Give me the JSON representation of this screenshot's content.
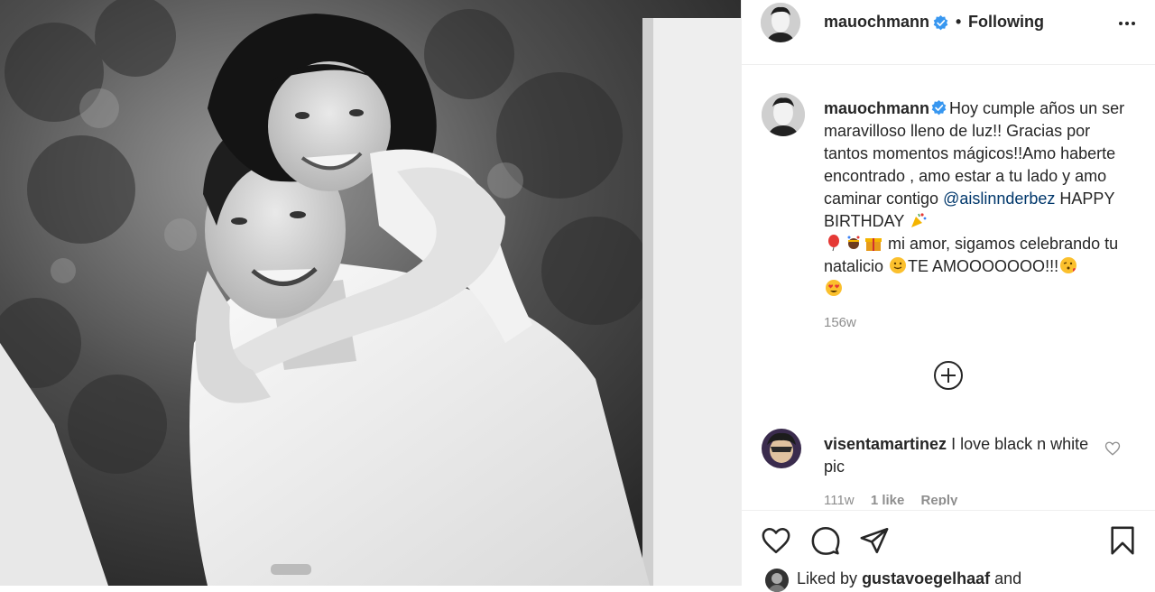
{
  "post": {
    "author": "mauochmann",
    "follow_status": "Following",
    "separator": "•"
  },
  "caption": {
    "username": "mauochmann",
    "text_part1": "Hoy cumple años un ser maravilloso lleno de luz!! Gracias por tantos momentos mágicos!!Amo haberte encontrado , amo estar a tu lado y amo caminar contigo ",
    "mention": "@aislinnderbez",
    "text_part2": " HAPPY BIRTHDAY ",
    "text_part3": " mi amor, sigamos celebrando tu natalicio ",
    "text_part4": "TE AMOOOOOOO!!!",
    "emojis": [
      "party-popper",
      "balloon",
      "confetti-ball",
      "gift",
      "smiling-face",
      "kissing-face",
      "heart-eyes"
    ],
    "time": "156w"
  },
  "comment": {
    "username": "visentamartinez",
    "text": "I love black n white pic",
    "time": "111w",
    "likes": "1 like",
    "reply": "Reply"
  },
  "actions": {
    "icons": [
      "heart-icon",
      "comment-bubble-icon",
      "share-plane-icon",
      "bookmark-icon"
    ]
  },
  "liked_by": {
    "prefix": "Liked by",
    "user": "gustavoegelhaaf",
    "suffix": "and"
  },
  "colors": {
    "verified": "#3897f0",
    "mention": "#00376b",
    "secondary_text": "#8e8e8e",
    "border": "#efefef"
  }
}
